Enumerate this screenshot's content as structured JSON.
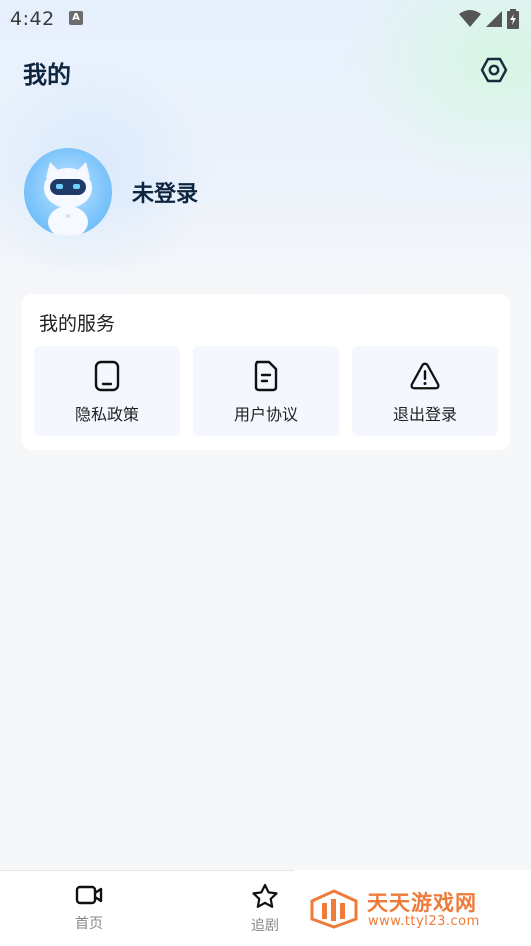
{
  "status_bar": {
    "time": "4:42",
    "notification_letter": "A"
  },
  "header": {
    "title": "我的"
  },
  "profile": {
    "login_status": "未登录"
  },
  "services": {
    "title": "我的服务",
    "items": [
      {
        "label": "隐私政策",
        "icon": "phone-icon"
      },
      {
        "label": "用户协议",
        "icon": "document-icon"
      },
      {
        "label": "退出登录",
        "icon": "warning-icon"
      }
    ]
  },
  "bottom_nav": {
    "items": [
      {
        "label": "首页",
        "icon": "video-icon"
      },
      {
        "label": "追剧",
        "icon": "star-icon"
      }
    ]
  },
  "watermark": {
    "title": "天天游戏网",
    "url": "www.ttyl23.com"
  },
  "colors": {
    "title": "#0e2540",
    "accent": "#ef7b3a",
    "card_item_bg": "#f4f8fe"
  }
}
